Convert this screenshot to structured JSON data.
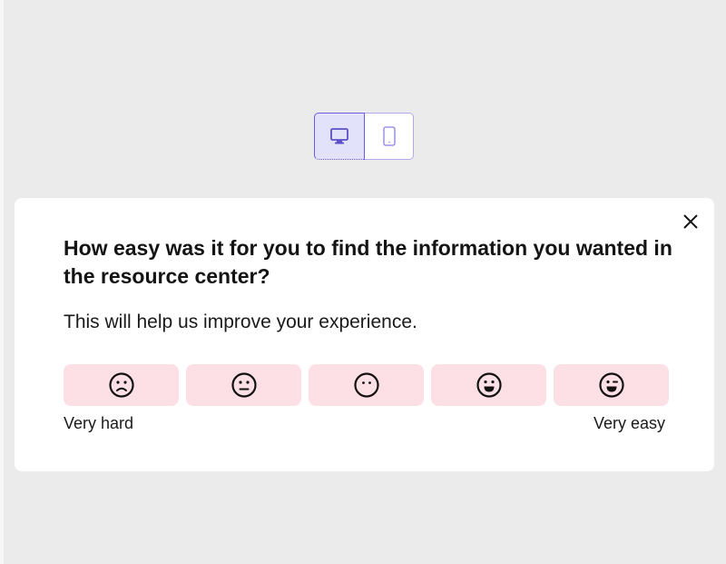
{
  "device_toggle": {
    "desktop_icon": "desktop-monitor-icon",
    "mobile_icon": "mobile-phone-icon",
    "selected": "desktop",
    "accent_color": "#6b5ce0"
  },
  "survey": {
    "question": "How easy was it for you to find the information you wanted in the resource center?",
    "subtext": "This will help us improve your experience.",
    "close_icon": "close-icon",
    "options": [
      {
        "icon": "frown-face-icon"
      },
      {
        "icon": "neutral-face-icon"
      },
      {
        "icon": "blank-face-icon"
      },
      {
        "icon": "grin-face-icon"
      },
      {
        "icon": "wink-face-icon"
      }
    ],
    "min_label": "Very hard",
    "max_label": "Very easy",
    "option_color": "#fde0e6"
  }
}
